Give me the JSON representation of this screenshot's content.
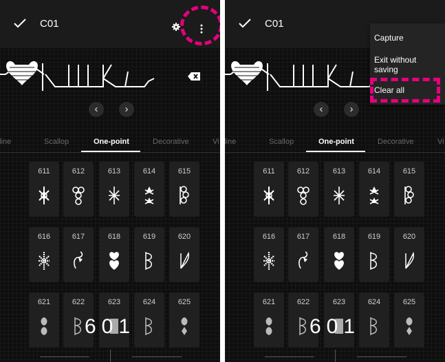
{
  "app": {
    "title": "C01"
  },
  "tabs": [
    {
      "label": "Straight line",
      "visible_text": "t line"
    },
    {
      "label": "Scallop",
      "visible_text": "Scallop"
    },
    {
      "label": "One-point",
      "visible_text": "One-point"
    },
    {
      "label": "Decorative",
      "visible_text": "Decorative"
    },
    {
      "label": "Vi",
      "visible_text": "Vi"
    }
  ],
  "active_tab": "One-point",
  "patterns": [
    "611",
    "612",
    "613",
    "614",
    "615",
    "616",
    "617",
    "618",
    "619",
    "620",
    "621",
    "622",
    "623",
    "624",
    "625"
  ],
  "counter": {
    "value": "601"
  },
  "overflow_menu": {
    "items": [
      {
        "label": "Capture"
      },
      {
        "label": "Exit without saving",
        "line1": "Exit without",
        "line2": "saving"
      },
      {
        "label": "Clear all"
      }
    ]
  },
  "annotation": {
    "color": "#e6007e"
  },
  "colors": {
    "background": "#0e0e0e",
    "topbar": "#1b1b1b",
    "tile": "#202020",
    "text": "#ffffff"
  },
  "icons": [
    "check-icon",
    "gear-icon",
    "more-vert-icon",
    "backspace-icon",
    "chevron-left-icon",
    "chevron-right-icon"
  ]
}
